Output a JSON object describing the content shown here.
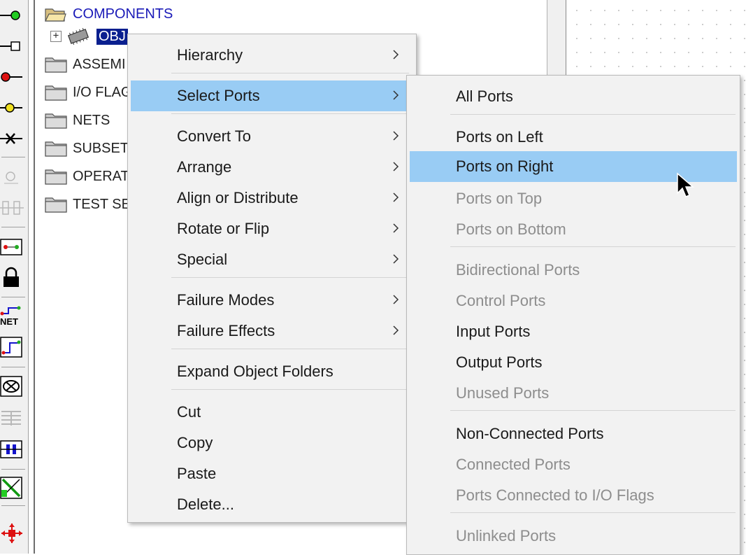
{
  "tree": {
    "items": [
      {
        "label": "COMPONENTS",
        "style": "blue",
        "icon": "open-folder-icon"
      },
      {
        "label": "OBJ",
        "style": "selected",
        "icon": "chip-icon",
        "expander": "+"
      },
      {
        "label": "ASSEMI",
        "icon": "folder-icon"
      },
      {
        "label": "I/O FLAG",
        "icon": "folder-icon"
      },
      {
        "label": "NETS",
        "icon": "folder-icon"
      },
      {
        "label": "SUBSET",
        "icon": "folder-icon"
      },
      {
        "label": "OPERAT",
        "icon": "folder-icon"
      },
      {
        "label": "TEST SE",
        "icon": "folder-icon"
      }
    ]
  },
  "context_menu": {
    "items": [
      {
        "label": "Hierarchy",
        "submenu": true
      },
      {
        "label": "Select Ports",
        "submenu": true,
        "highlighted": true
      },
      {
        "label": "Convert To",
        "submenu": true
      },
      {
        "label": "Arrange",
        "submenu": true
      },
      {
        "label": "Align or Distribute",
        "submenu": true
      },
      {
        "label": "Rotate or Flip",
        "submenu": true
      },
      {
        "label": "Special",
        "submenu": true
      },
      {
        "label": "Failure Modes",
        "submenu": true
      },
      {
        "label": "Failure Effects",
        "submenu": true
      },
      {
        "label": "Expand Object Folders"
      },
      {
        "label": "Cut"
      },
      {
        "label": "Copy"
      },
      {
        "label": "Paste"
      },
      {
        "label": "Delete..."
      }
    ]
  },
  "submenu": {
    "items": [
      {
        "label": "All Ports"
      },
      {
        "label": "Ports on Left"
      },
      {
        "label": "Ports on Right",
        "highlighted": true
      },
      {
        "label": "Ports on Top",
        "disabled": true
      },
      {
        "label": "Ports on Bottom",
        "disabled": true
      },
      {
        "label": "Bidirectional Ports",
        "disabled": true
      },
      {
        "label": "Control Ports",
        "disabled": true
      },
      {
        "label": "Input Ports"
      },
      {
        "label": "Output Ports"
      },
      {
        "label": "Unused Ports",
        "disabled": true
      },
      {
        "label": "Non-Connected Ports"
      },
      {
        "label": "Connected Ports",
        "disabled": true
      },
      {
        "label": "Ports Connected to I/O Flags",
        "disabled": true
      },
      {
        "label": "Unlinked Ports",
        "disabled": true
      }
    ]
  },
  "toolbar": {
    "net_label": "NET"
  },
  "colors": {
    "highlight": "#99ccf4",
    "selected_tree": "#0a1f8f",
    "tree_blue_text": "#1a1ab8",
    "disabled_text": "#8d8d8d"
  }
}
